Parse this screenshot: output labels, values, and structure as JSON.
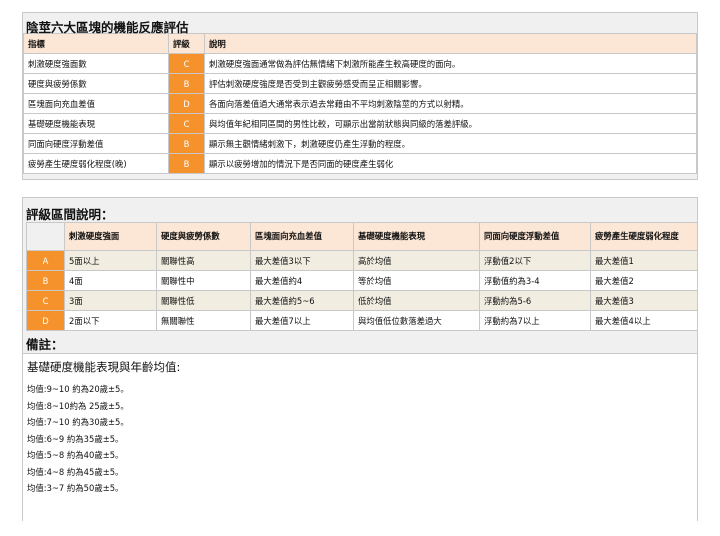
{
  "panel1": {
    "title": "陰莖六大區塊的機能反應評估",
    "headers": [
      "指標",
      "評級",
      "說明"
    ],
    "rows": [
      {
        "indicator": "刺激硬度強面數",
        "grade": "C",
        "desc": "刺激硬度強面通常做為評估無情緒下刺激所能產生較高硬度的面向。"
      },
      {
        "indicator": "硬度與疲勞係數",
        "grade": "B",
        "desc": "評估刺激硬度強度是否受到主觀疲勞感受而呈正相關影響。"
      },
      {
        "indicator": "區塊面向充血差值",
        "grade": "D",
        "desc": "各面向落差值過大通常表示過去常藉由不平均刺激陰莖的方式以射精。"
      },
      {
        "indicator": "基礎硬度機能表現",
        "grade": "C",
        "desc": "與均值年紀相同區間的男性比較，可顯示出當前狀態與同級的落差評級。"
      },
      {
        "indicator": "同面向硬度浮動差值",
        "grade": "B",
        "desc": "顯示無主觀情緒刺激下，刺激硬度仍產生浮動的程度。"
      },
      {
        "indicator": "疲勞產生硬度弱化程度(晚)",
        "grade": "B",
        "desc": "顯示以疲勞增加的情況下是否同面的硬度產生弱化"
      }
    ]
  },
  "panel2": {
    "title": "評級區間說明：",
    "headers": [
      "",
      "刺激硬度強面",
      "硬度與疲勞係數",
      "區塊面向充血差值",
      "基礎硬度機能表現",
      "同面向硬度浮動差值",
      "疲勞產生硬度弱化程度"
    ],
    "rows": [
      {
        "grade": "A",
        "cells": [
          "5面以上",
          "關聯性高",
          "最大差值3以下",
          "高於均值",
          "浮動值2以下",
          "最大差值1"
        ]
      },
      {
        "grade": "B",
        "cells": [
          "4面",
          "關聯性中",
          "最大差值約4",
          "等於均值",
          "浮動值約為3-4",
          "最大差值2"
        ]
      },
      {
        "grade": "C",
        "cells": [
          "3面",
          "關聯性低",
          "最大差值約5~6",
          "低於均值",
          "浮動約為5-6",
          "最大差值3"
        ]
      },
      {
        "grade": "D",
        "cells": [
          "2面以下",
          "無關聯性",
          "最大差值7以上",
          "與均值低位數落差過大",
          "浮動約為7以上",
          "最大差值4以上"
        ]
      }
    ]
  },
  "notes": {
    "title": "備註：",
    "heading": "基礎硬度機能表現與年齡均值:",
    "lines": [
      "均值:9~10  約為20歲±5。",
      "均值:8~10約為  25歲±5。",
      "均值:7~10  約為30歲±5。",
      "均值:6~9   約為35歲±5。",
      "均值:5~8   約為40歲±5。",
      "均值:4~8   約為45歲±5。",
      "均值:3~7   約為50歲±5。"
    ]
  },
  "colors": {
    "accent": "#f5922b",
    "header_bg": "#fce6d5",
    "panel_bg": "#f0f0f0",
    "shaded_row": "#f1ede1"
  }
}
